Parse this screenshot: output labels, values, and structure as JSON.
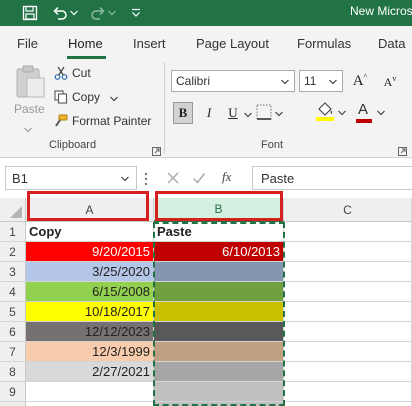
{
  "titlebar": {
    "title": "New Micros"
  },
  "tabs": [
    {
      "label": "File"
    },
    {
      "label": "Home"
    },
    {
      "label": "Insert"
    },
    {
      "label": "Page Layout"
    },
    {
      "label": "Formulas"
    },
    {
      "label": "Data"
    }
  ],
  "clipboard": {
    "paste": "Paste",
    "cut": "Cut",
    "copy": "Copy",
    "format_painter": "Format Painter",
    "group": "Clipboard"
  },
  "font": {
    "name": "Calibri",
    "size": "11",
    "bold": "B",
    "italic": "I",
    "underline": "U",
    "grow": "A",
    "shrink": "A",
    "font_color": "A",
    "group": "Font"
  },
  "formula_bar": {
    "name_box": "B1",
    "fx": "fx",
    "content": "Paste"
  },
  "columns": [
    "A",
    "B",
    "C"
  ],
  "rows": [
    {
      "num": "1",
      "a": "Copy",
      "b": "Paste",
      "a_color": "#ffffff",
      "b_color": "#ffffff"
    },
    {
      "num": "2",
      "a": "9/20/2015",
      "b": "6/10/2013",
      "a_color": "#ff0000",
      "b_color": "#c00000"
    },
    {
      "num": "3",
      "a": "3/25/2020",
      "b": "",
      "a_color": "#b4c6e7",
      "b_color": "#8497b0"
    },
    {
      "num": "4",
      "a": "6/15/2008",
      "b": "",
      "a_color": "#92d050",
      "b_color": "#70a040"
    },
    {
      "num": "5",
      "a": "10/18/2017",
      "b": "",
      "a_color": "#ffff00",
      "b_color": "#c9c000"
    },
    {
      "num": "6",
      "a": "12/12/2023",
      "b": "",
      "a_color": "#767171",
      "b_color": "#595959"
    },
    {
      "num": "7",
      "a": "12/3/1999",
      "b": "",
      "a_color": "#f8cbad",
      "b_color": "#c0a080"
    },
    {
      "num": "8",
      "a": "2/27/2021",
      "b": "",
      "a_color": "#d9d9d9",
      "b_color": "#a6a6a6"
    },
    {
      "num": "9",
      "a": "",
      "b": "",
      "a_color": "#ffffff",
      "b_color": "#bfbfbf"
    },
    {
      "num": "",
      "a": "",
      "b": "",
      "a_color": "#ffffff",
      "b_color": "#bfbfbf"
    }
  ],
  "colors": {
    "accent": "#217346",
    "highlight_box": "#d62020"
  }
}
